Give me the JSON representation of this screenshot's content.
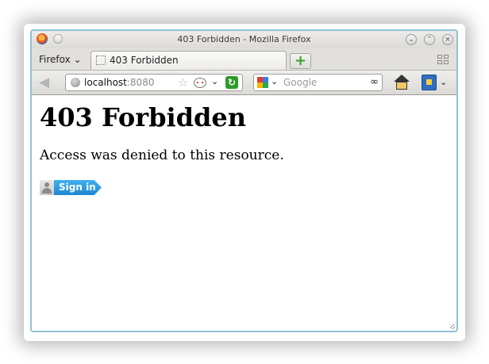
{
  "window": {
    "title": "403 Forbidden - Mozilla Firefox",
    "controls": [
      "minimize",
      "maximize",
      "close"
    ]
  },
  "tabbar": {
    "menu_label": "Firefox",
    "tabs": [
      {
        "label": "403 Forbidden"
      }
    ],
    "new_tab_label": "+"
  },
  "navbar": {
    "url_host": "localhost",
    "url_port": ":8080",
    "search_placeholder": "Google"
  },
  "page": {
    "heading": "403 Forbidden",
    "message": "Access was denied to this resource.",
    "signin_label": "Sign in"
  },
  "icons": {
    "back": "back-arrow-icon",
    "reload": "reload-icon",
    "home": "home-icon",
    "bookmarks": "bookmarks-icon",
    "search_engine": "google-icon"
  },
  "colors": {
    "signin_button": "#1c87d3",
    "window_border": "#8fc3d2",
    "reload": "#2d9a2a"
  }
}
